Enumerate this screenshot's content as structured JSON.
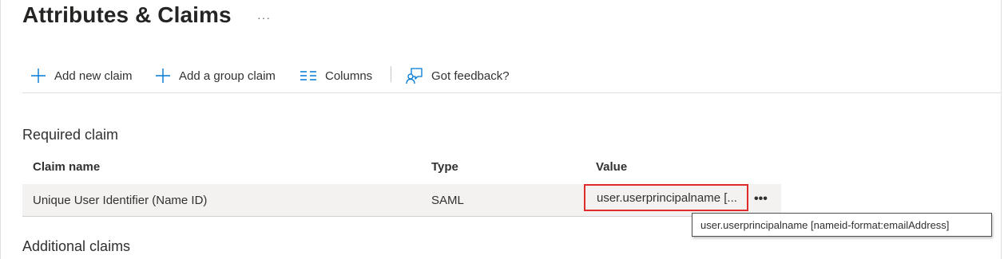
{
  "page": {
    "title": "Attributes & Claims",
    "more_label": "···"
  },
  "toolbar": {
    "add_new_claim": "Add new claim",
    "add_group_claim": "Add a group claim",
    "columns": "Columns",
    "got_feedback": "Got feedback?"
  },
  "required": {
    "section_title": "Required claim",
    "columns": [
      "Claim name",
      "Type",
      "Value"
    ],
    "rows": [
      {
        "claim_name": "Unique User Identifier (Name ID)",
        "type": "SAML",
        "value": "user.userprincipalname [...",
        "more": "•••"
      }
    ]
  },
  "tooltip": {
    "text": "user.userprincipalname [nameid-format:emailAddress]"
  },
  "additional": {
    "section_title": "Additional claims"
  },
  "colors": {
    "highlight_border": "#e02b2b",
    "row_background": "#f3f2f1",
    "icon_blue": "#0078d4"
  }
}
